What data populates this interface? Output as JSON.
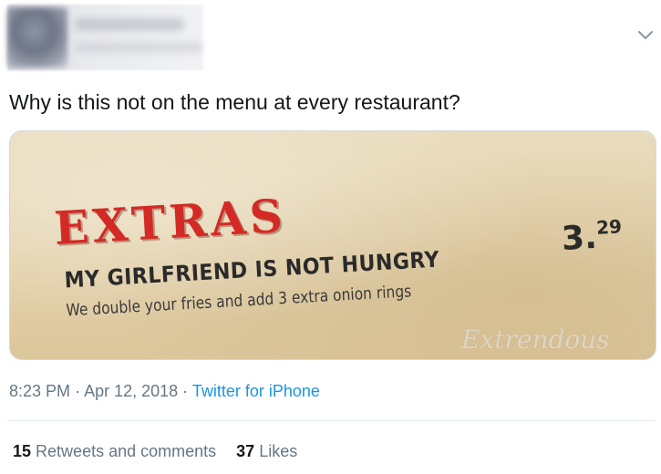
{
  "tweet": {
    "text": "Why is this not on the menu at every restaurant?",
    "time": "8:23 PM",
    "date": "Apr 12, 2018",
    "separator": "·",
    "source": "Twitter for iPhone",
    "retweets_count": "15",
    "retweets_label": "Retweets and comments",
    "likes_count": "37",
    "likes_label": "Likes"
  },
  "menu_image": {
    "heading": "EXTRAS",
    "item_title": "MY GIRLFRIEND IS NOT HUNGRY",
    "item_description": "We double your fries and add 3 extra onion rings",
    "price_main": "3.",
    "price_cents": "29",
    "watermark": "Extrendous"
  },
  "colors": {
    "link": "#1b95e0",
    "meta_text": "#657786",
    "menu_heading": "#d42a25"
  },
  "icons": {
    "more": "chevron-down-icon"
  }
}
